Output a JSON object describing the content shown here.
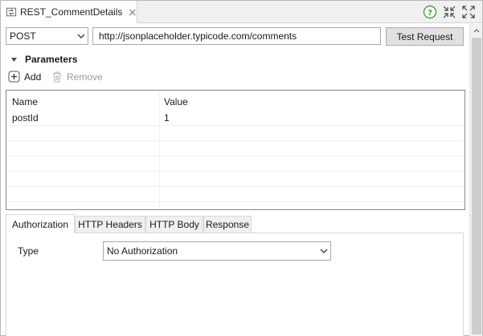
{
  "editor": {
    "tab_title": "REST_CommentDetails"
  },
  "request": {
    "method": "POST",
    "url": "http://jsonplaceholder.typicode.com/comments",
    "test_button": "Test Request"
  },
  "parameters": {
    "title": "Parameters",
    "add_label": "Add",
    "remove_label": "Remove",
    "columns": [
      "Name",
      "Value"
    ],
    "rows": [
      {
        "name": "postId",
        "value": "1"
      }
    ]
  },
  "tabs": {
    "items": [
      "Authorization",
      "HTTP Headers",
      "HTTP Body",
      "Response"
    ],
    "active": "Authorization"
  },
  "authorization": {
    "type_label": "Type",
    "type_value": "No Authorization"
  },
  "icons": {
    "tab": "rest-file-icon",
    "close": "close-icon",
    "help": "help-icon",
    "minimize": "minimize-icon",
    "maximize": "maximize-icon",
    "add": "add-icon",
    "remove": "trash-icon",
    "toggle": "expand-triangle-icon",
    "dropdown": "chevron-down-icon"
  },
  "colors": {
    "help_green": "#3ea43a",
    "accent_gray": "#4a4a4a"
  }
}
